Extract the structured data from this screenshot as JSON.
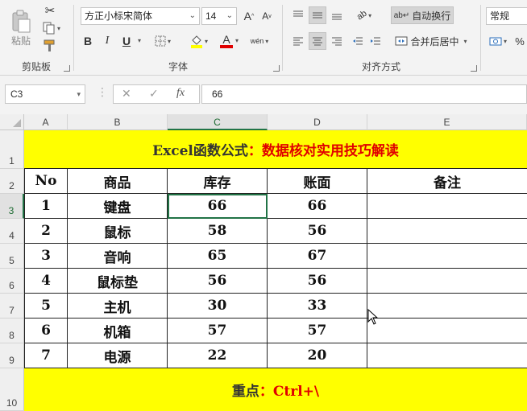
{
  "ribbon": {
    "clipboard": {
      "paste_label": "粘贴",
      "group_label": "剪贴板"
    },
    "font": {
      "font_name": "方正小标宋简体",
      "font_size": "14",
      "grow_label": "A",
      "shrink_label": "A",
      "bold": "B",
      "italic": "I",
      "underline": "U",
      "group_label": "字体",
      "font_color_label": "A",
      "phonetic_label": "wén"
    },
    "alignment": {
      "wrap_text": "自动换行",
      "merge_center": "合并后居中",
      "group_label": "对齐方式"
    },
    "number": {
      "format": "常规",
      "percent": "%"
    }
  },
  "formula_bar": {
    "name_box": "C3",
    "formula": "66",
    "fx": "fx"
  },
  "columns": [
    "A",
    "B",
    "C",
    "D",
    "E"
  ],
  "rows": [
    "1",
    "2",
    "3",
    "4",
    "5",
    "6",
    "7",
    "8",
    "9",
    "10"
  ],
  "sheet": {
    "title_black": "Excel函数公式",
    "title_red": "：数据核对实用技巧解读",
    "headers": [
      "No",
      "商品",
      "库存",
      "账面",
      "备注"
    ],
    "data": [
      [
        "1",
        "键盘",
        "66",
        "66",
        ""
      ],
      [
        "2",
        "鼠标",
        "58",
        "56",
        ""
      ],
      [
        "3",
        "音响",
        "65",
        "67",
        ""
      ],
      [
        "4",
        "鼠标垫",
        "56",
        "56",
        ""
      ],
      [
        "5",
        "主机",
        "30",
        "33",
        ""
      ],
      [
        "6",
        "机箱",
        "57",
        "57",
        ""
      ],
      [
        "7",
        "电源",
        "22",
        "20",
        ""
      ]
    ],
    "footer_black": "重点",
    "footer_red": "：Ctrl+\\"
  },
  "colors": {
    "banner": "#ffff00",
    "red": "#e00000",
    "accent": "#217346"
  }
}
